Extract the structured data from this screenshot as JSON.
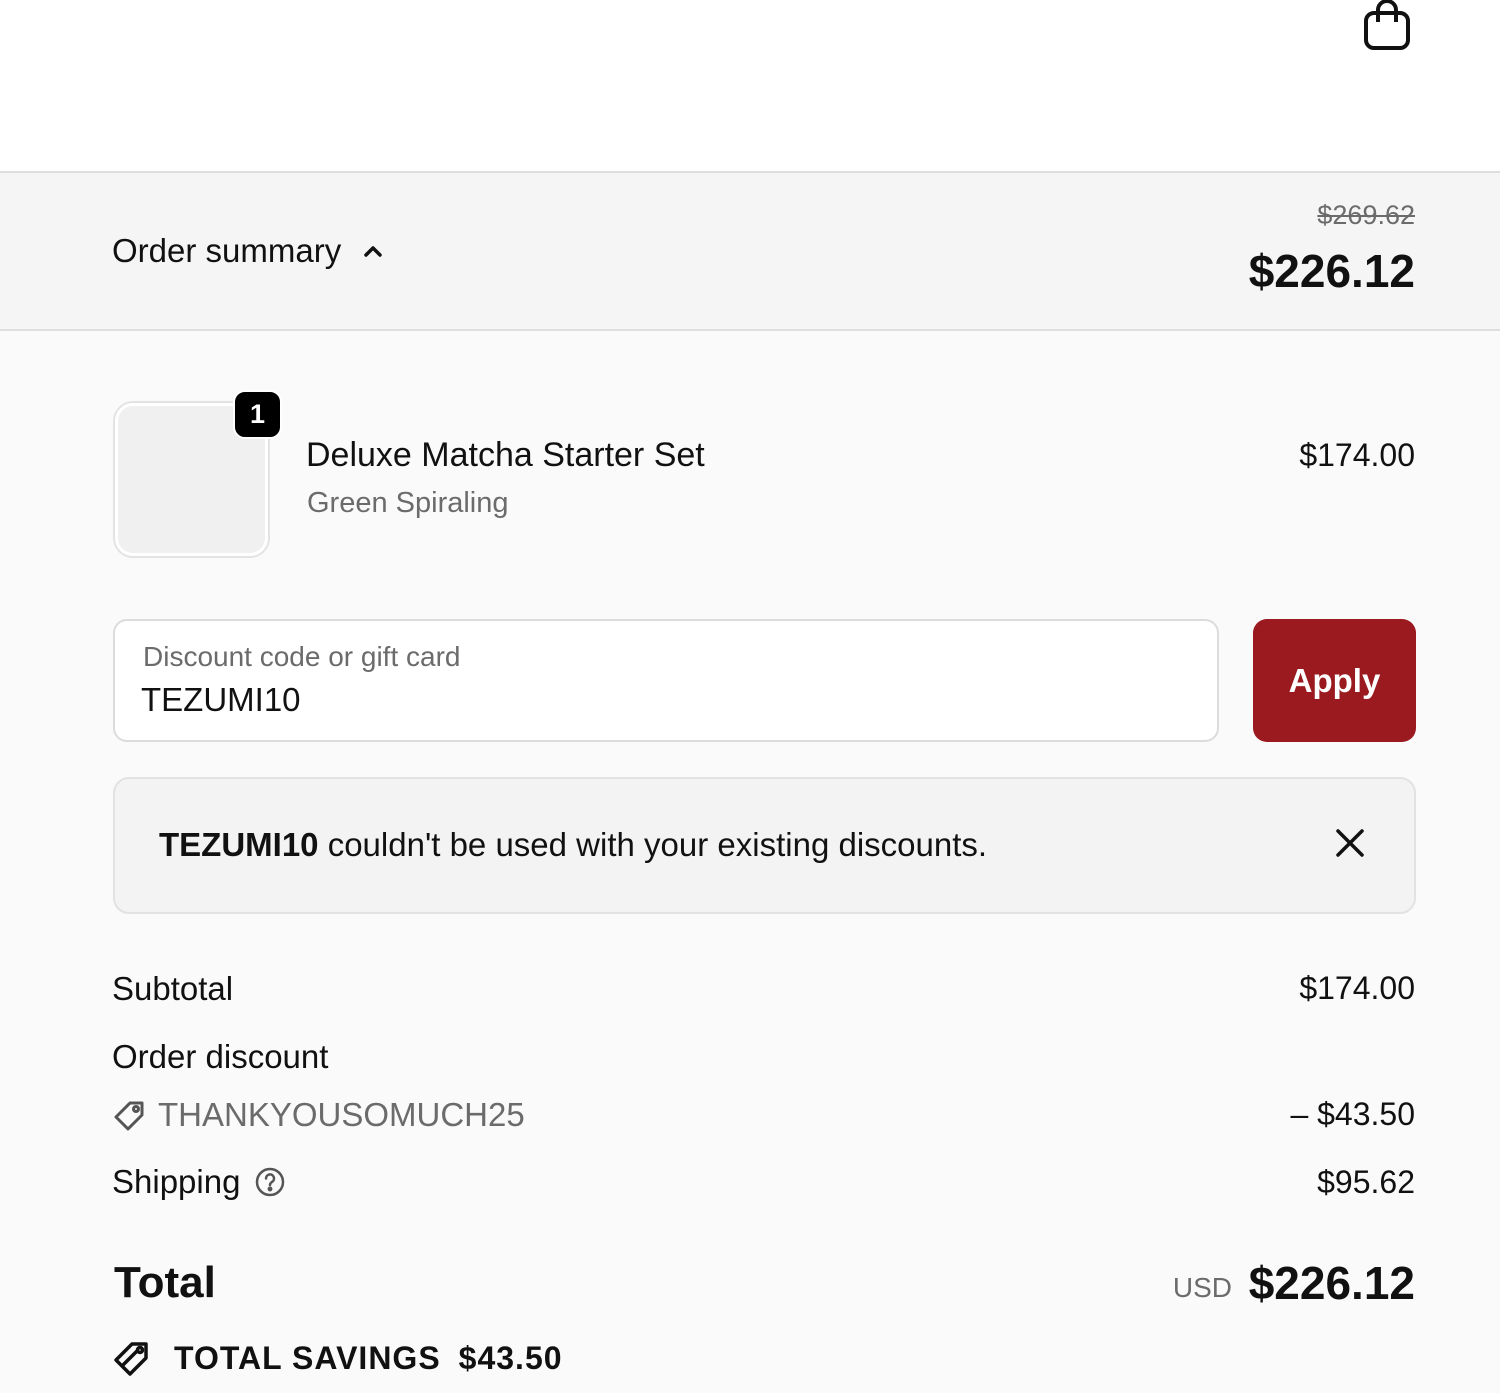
{
  "header": {
    "cart_icon": "shopping-bag-icon"
  },
  "summary": {
    "toggle_label": "Order summary",
    "toggle_icon": "chevron-up-icon",
    "original_price": "$269.62",
    "total": "$226.12"
  },
  "line_items": [
    {
      "quantity": "1",
      "name": "Deluxe Matcha Starter Set",
      "variant": "Green Spiraling",
      "price": "$174.00"
    }
  ],
  "discount": {
    "label": "Discount code or gift card",
    "value": "TEZUMI10",
    "apply_label": "Apply",
    "apply_color": "#9a1a1f"
  },
  "alert": {
    "code": "TEZUMI10",
    "message": "couldn't be used with your existing discounts.",
    "close_icon": "close-icon"
  },
  "totals": {
    "subtotal_label": "Subtotal",
    "subtotal_value": "$174.00",
    "order_discount_label": "Order discount",
    "discount_code": "THANKYOUSOMUCH25",
    "discount_value": "– $43.50",
    "shipping_label": "Shipping",
    "shipping_value": "$95.62",
    "total_label": "Total",
    "currency": "USD",
    "total_value": "$226.12",
    "savings_label": "TOTAL SAVINGS",
    "savings_value": "$43.50"
  }
}
